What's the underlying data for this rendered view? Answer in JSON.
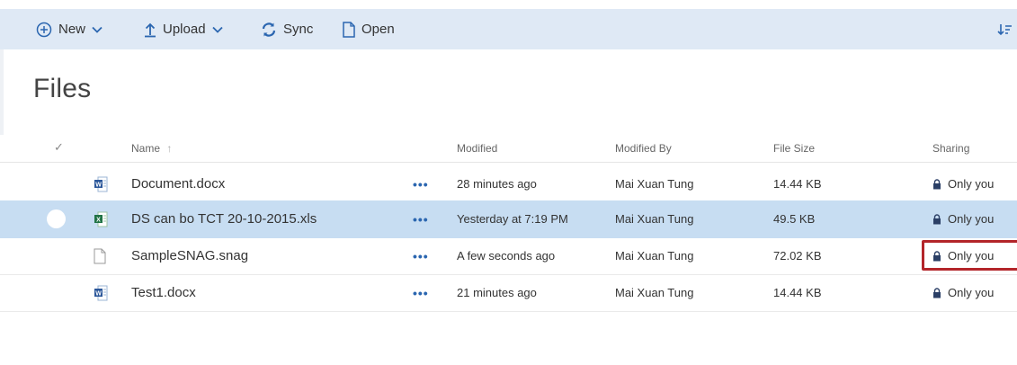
{
  "toolbar": {
    "new_label": "New",
    "upload_label": "Upload",
    "sync_label": "Sync",
    "open_label": "Open"
  },
  "page": {
    "title": "Files"
  },
  "columns": {
    "name": "Name",
    "name_sort": "↑",
    "modified": "Modified",
    "modified_by": "Modified By",
    "file_size": "File Size",
    "sharing": "Sharing"
  },
  "files": [
    {
      "icon": "word-doc-icon",
      "name": "Document.docx",
      "actions": "•••",
      "modified": "28 minutes ago",
      "modified_by": "Mai Xuan Tung",
      "size": "14.44 KB",
      "sharing": "Only you"
    },
    {
      "icon": "excel-doc-icon",
      "name": "DS can bo TCT 20-10-2015.xls",
      "actions": "•••",
      "modified": "Yesterday at 7:19 PM",
      "modified_by": "Mai Xuan Tung",
      "size": "49.5 KB",
      "sharing": "Only you"
    },
    {
      "icon": "generic-file-icon",
      "name": "SampleSNAG.snag",
      "actions": "•••",
      "modified": "A few seconds ago",
      "modified_by": "Mai Xuan Tung",
      "size": "72.02 KB",
      "sharing": "Only you"
    },
    {
      "icon": "word-doc-icon",
      "name": "Test1.docx",
      "actions": "•••",
      "modified": "21 minutes ago",
      "modified_by": "Mai Xuan Tung",
      "size": "14.44 KB",
      "sharing": "Only you"
    }
  ],
  "colors": {
    "accent": "#2b66b0",
    "command_bar": "#dfe9f5",
    "selected_row": "#c7ddf2",
    "highlight_border": "#b3252a"
  }
}
